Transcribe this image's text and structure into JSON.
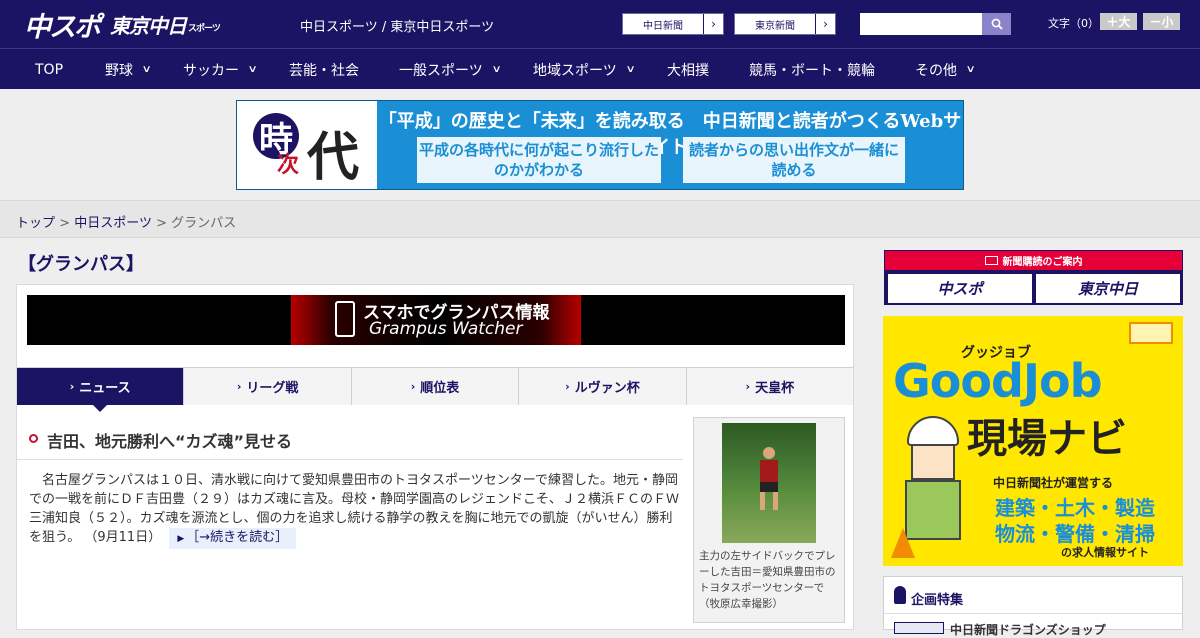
{
  "header": {
    "logo_chuspo": "中スポ",
    "logo_tokyo": "東京中日",
    "logo_tokyo_sub": "スポーツ",
    "title": "中日スポーツ / 東京中日スポーツ",
    "paper_links": [
      "中日新聞",
      "東京新聞"
    ],
    "search_placeholder": "",
    "font_size_label": "文字（0）",
    "font_bigger": "＋大",
    "font_smaller": "－小"
  },
  "nav": {
    "items": [
      {
        "label": "TOP",
        "has_menu": false
      },
      {
        "label": "野球",
        "has_menu": true
      },
      {
        "label": "サッカー",
        "has_menu": true
      },
      {
        "label": "芸能・社会",
        "has_menu": false
      },
      {
        "label": "一般スポーツ",
        "has_menu": true
      },
      {
        "label": "地域スポーツ",
        "has_menu": true
      },
      {
        "label": "大相撲",
        "has_menu": false
      },
      {
        "label": "競馬・ボート・競輪",
        "has_menu": false
      },
      {
        "label": "その他",
        "has_menu": true
      }
    ]
  },
  "top_banner": {
    "kanji_1": "時",
    "kanji_2": "次",
    "kanji_3": "代",
    "headline": "「平成」の歴史と「未来」を読み取る　中日新聞と読者がつくるWebサイト",
    "box1": "平成の各時代に何が起こり流行したのかがわかる",
    "box2": "読者からの思い出作文が一緒に読める"
  },
  "breadcrumb": {
    "home": "トップ",
    "separator": ">",
    "parent": "中日スポーツ",
    "current": "グランパス"
  },
  "section_title": "【グランパス】",
  "promo": {
    "line1": "スマホでグランパス情報",
    "line2": "Grampus Watcher"
  },
  "tabs": [
    {
      "label": "ニュース",
      "active": true
    },
    {
      "label": "リーグ戦",
      "active": false
    },
    {
      "label": "順位表",
      "active": false
    },
    {
      "label": "ルヴァン杯",
      "active": false
    },
    {
      "label": "天皇杯",
      "active": false
    }
  ],
  "article": {
    "title": "吉田、地元勝利へ“カズ魂”見せる",
    "body": "　名古屋グランパスは１０日、清水戦に向けて愛知県豊田市のトヨタスポーツセンターで練習した。地元・静岡での一戦を前にＤＦ吉田豊（２９）はカズ魂に言及。母校・静岡学園高のレジェンドこそ、Ｊ２横浜ＦＣのＦＷ三浦知良（５２）。カズ魂を源流とし、個の力を追求し続ける静学の教えを胸に地元での凱旋（がいせん）勝利を狙う。",
    "date": "（9月11日）",
    "read_more": "［→続きを読む］",
    "photo_caption": "主力の左サイドバックでプレーした吉田＝愛知県豊田市のトヨタスポーツセンターで（牧原広幸撮影）"
  },
  "sidebar": {
    "subscription_header": "新聞購読のご案内",
    "subscription_logos": [
      "中スポ",
      "東京中日"
    ],
    "goodjob_ruby": "グッジョブ",
    "goodjob_title": "GoodJob",
    "goodjob_sub": "現場ナビ",
    "goodjob_line1": "中日新聞社が運営する",
    "goodjob_line2": "建築・土木・製造",
    "goodjob_line3": "物流・警備・清掃",
    "goodjob_line4": "の求人情報サイト",
    "feature_title": "企画特集",
    "feature_item": "中日新聞ドラゴンズショップ"
  },
  "colors": {
    "brand_navy": "#1b1464",
    "accent_red": "#e60039",
    "goodjob_yellow": "#ffe700",
    "goodjob_blue": "#1a8fd6"
  }
}
